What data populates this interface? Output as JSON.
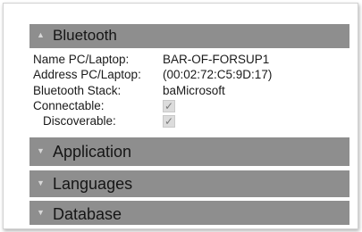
{
  "bluetooth": {
    "title": "Bluetooth",
    "toggle_icon": "chevron-up-icon",
    "name_label": "Name PC/Laptop:",
    "name_value": "BAR-OF-FORSUP1",
    "address_label": "Address PC/Laptop:",
    "address_value": "(00:02:72:C5:9D:17)",
    "stack_label": "Bluetooth Stack:",
    "stack_value": "baMicrosoft",
    "connectable_label": "Connectable:",
    "connectable_checked": true,
    "discoverable_label": "Discoverable:",
    "discoverable_checked": true
  },
  "sections": {
    "application": "Application",
    "languages": "Languages",
    "database": "Database",
    "toggle_icon": "chevron-down-icon"
  },
  "colors": {
    "header_bg": "#8e8e8e",
    "checkbox_bg": "#dcdcdc"
  }
}
